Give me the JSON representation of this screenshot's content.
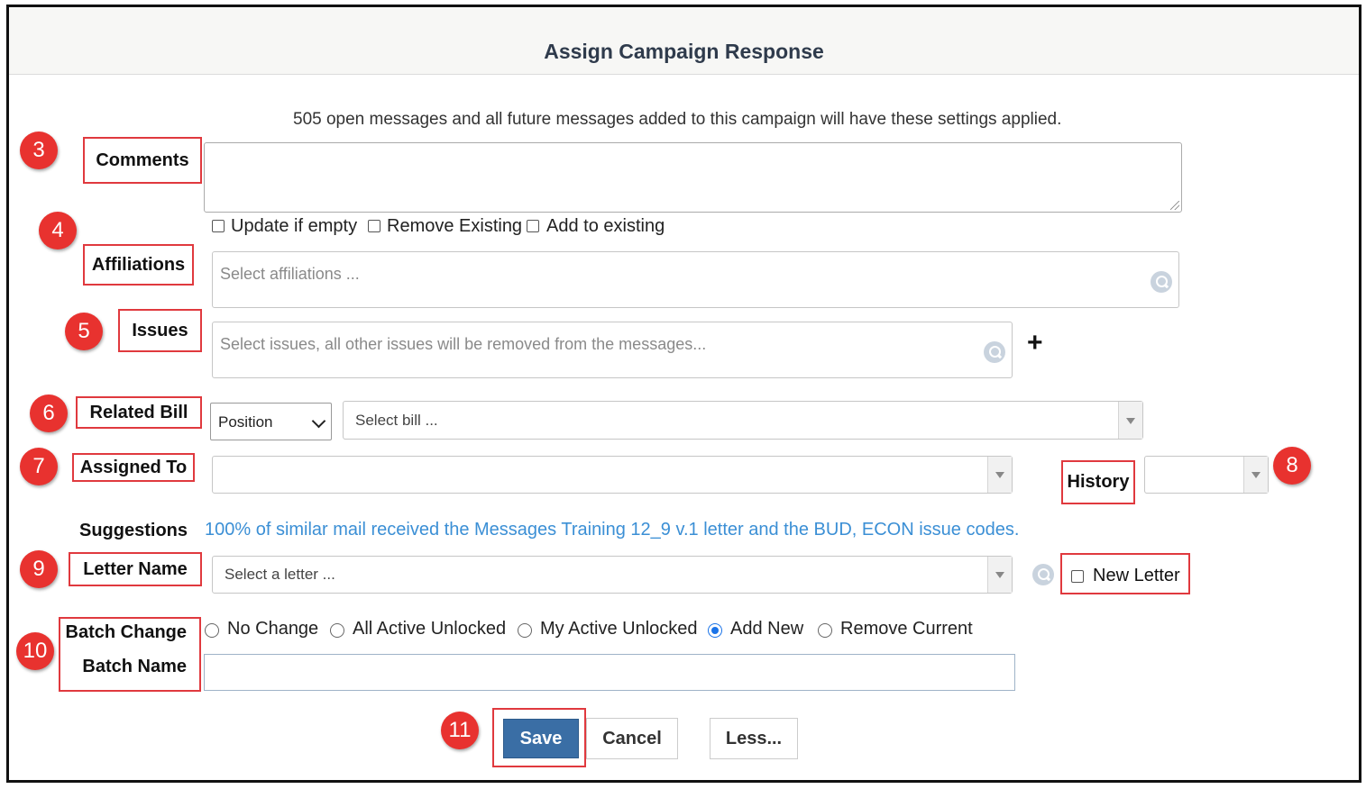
{
  "dialog": {
    "title": "Assign Campaign Response",
    "info_text": "505 open messages and all future messages added to this campaign will have these settings applied."
  },
  "callouts": [
    "3",
    "4",
    "5",
    "6",
    "7",
    "8",
    "9",
    "10",
    "11"
  ],
  "fields": {
    "comments_label": "Comments",
    "affiliations_label": "Affiliations",
    "affiliation_options": [
      "Update if empty",
      "Remove Existing",
      "Add to existing"
    ],
    "affiliations_placeholder": "Select affiliations ...",
    "issues_label": "Issues",
    "issues_placeholder": "Select issues, all other issues will be removed from the messages...",
    "add_issue_glyph": "+",
    "related_bill_label": "Related Bill",
    "position_value": "Position",
    "bill_placeholder": "Select bill ...",
    "assigned_to_label": "Assigned To",
    "assigned_to_value": "",
    "history_label": "History",
    "history_value": "",
    "suggestions_label": "Suggestions",
    "suggestions_text": "100% of similar mail received the Messages Training 12_9 v.1 letter and the BUD, ECON issue codes.",
    "letter_name_label": "Letter Name",
    "letter_placeholder": "Select a letter ...",
    "new_letter_label": "New Letter",
    "batch_change_label": "Batch Change",
    "batch_options": [
      "No Change",
      "All Active Unlocked",
      "My Active Unlocked",
      "Add New",
      "Remove Current"
    ],
    "batch_selected": "Add New",
    "batch_name_label": "Batch Name",
    "batch_name_value": ""
  },
  "buttons": {
    "save": "Save",
    "cancel": "Cancel",
    "less": "Less..."
  },
  "colors": {
    "callout_red": "#e8322f",
    "save_blue": "#3a6ea5",
    "suggestion_blue": "#3b8fd5"
  }
}
